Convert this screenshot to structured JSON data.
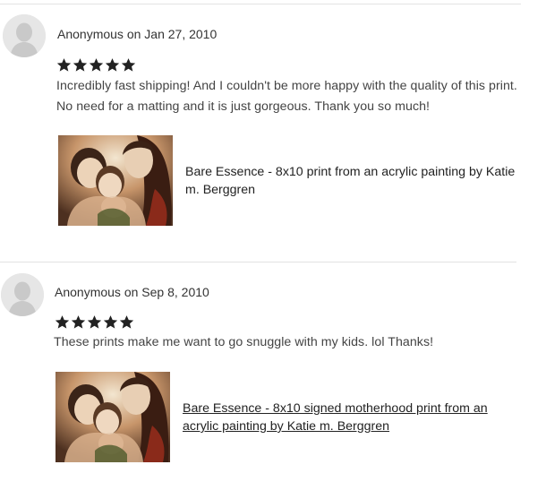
{
  "reviews": [
    {
      "reviewer": "Anonymous",
      "on_word": "on",
      "date": "Jan 27, 2010",
      "rating": 5,
      "text": "Incredibly fast shipping! And I couldn't be more happy with the quality of this print. No need for a matting and it is just gorgeous. Thank you so much!",
      "listing_title": "Bare Essence - 8x10 print from an acrylic painting by Katie m. Berggren",
      "listing_linked": false
    },
    {
      "reviewer": "Anonymous",
      "on_word": "on",
      "date": "Sep 8, 2010",
      "rating": 5,
      "text": "These prints make me want to go snuggle with my kids. lol Thanks!",
      "listing_title": "Bare Essence - 8x10 signed motherhood print from an acrylic painting by Katie m. Berggren",
      "listing_linked": true
    }
  ],
  "icons": {
    "avatar": "user-silhouette-icon",
    "star": "star-icon"
  },
  "colors": {
    "star": "#222222",
    "divider": "#e3e3e3",
    "avatar_bg": "#e9e9e9"
  }
}
